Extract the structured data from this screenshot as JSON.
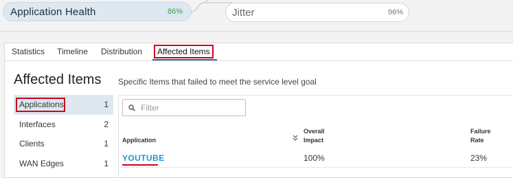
{
  "metrics": [
    {
      "label": "Application Health",
      "value": "86%"
    },
    {
      "label": "Jitter",
      "value": "96%"
    }
  ],
  "tabs": [
    {
      "label": "Statistics"
    },
    {
      "label": "Timeline"
    },
    {
      "label": "Distribution"
    },
    {
      "label": "Affected Items"
    }
  ],
  "section": {
    "title": "Affected Items",
    "description": "Specific Items that failed to meet the service level goal"
  },
  "sidebar": [
    {
      "label": "Applications",
      "count": "1"
    },
    {
      "label": "Interfaces",
      "count": "2"
    },
    {
      "label": "Clients",
      "count": "1"
    },
    {
      "label": "WAN Edges",
      "count": "1"
    }
  ],
  "filter": {
    "placeholder": "Filter",
    "icon": "search-icon"
  },
  "table": {
    "columns": [
      {
        "label": "Application"
      },
      {
        "label": "Overall\nImpact"
      },
      {
        "label": "Failure\nRate"
      }
    ],
    "rows": [
      {
        "application": "YOUTUBE",
        "impact": "100%",
        "failure_rate": "23%"
      }
    ]
  },
  "colors": {
    "accent": "#1b6fb5",
    "link": "#1b9ad6",
    "good": "#2fa34a",
    "highlight": "#d0021b",
    "selected_bg": "#dde8f0"
  }
}
